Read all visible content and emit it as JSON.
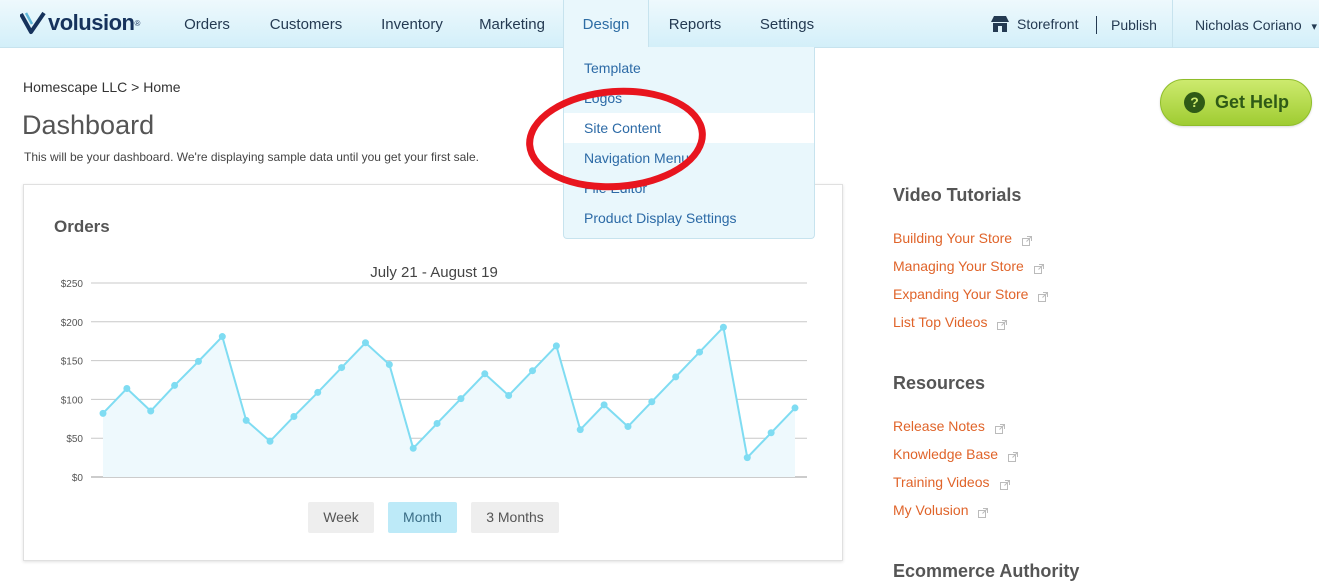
{
  "brand": {
    "name": "volusion",
    "reg": "®"
  },
  "nav": {
    "items": [
      "Orders",
      "Customers",
      "Inventory",
      "Marketing",
      "Design",
      "Reports",
      "Settings"
    ],
    "active": "Design",
    "storefront": "Storefront",
    "publish": "Publish",
    "user": "Nicholas Coriano",
    "user_caret": "▾"
  },
  "design_menu": {
    "items": [
      "Template",
      "Logos",
      "Site Content",
      "Navigation Menu",
      "File Editor",
      "Product Display Settings"
    ],
    "hover": "Site Content"
  },
  "breadcrumb": "Homescape LLC > Home",
  "page": {
    "title": "Dashboard",
    "subtitle": "This will be your dashboard. We're displaying sample data until you get your first sale."
  },
  "help": {
    "label": "Get Help",
    "icon": "?"
  },
  "orders_card": {
    "title": "Orders",
    "date_range": "July 21 - August 19",
    "range_buttons": [
      "Week",
      "Month",
      "3 Months"
    ],
    "active_range": "Month"
  },
  "chart_data": {
    "type": "area",
    "title": "July 21 - August 19",
    "xlabel": "",
    "ylabel": "",
    "ylim": [
      0,
      250
    ],
    "y_ticks": [
      "$0",
      "$50",
      "$100",
      "$150",
      "$200",
      "$250"
    ],
    "grid": true,
    "series": [
      {
        "values": [
          82,
          114,
          85,
          118,
          149,
          181,
          73,
          46,
          78,
          109,
          141,
          173,
          145,
          37,
          69,
          101,
          133,
          105,
          137,
          169,
          61,
          93,
          65,
          97,
          129,
          161,
          193,
          25,
          57,
          89
        ]
      }
    ],
    "line_color": "#7fdcf2",
    "fill_color": "#eef9fd"
  },
  "sidebar": {
    "video_tutorials": {
      "heading": "Video Tutorials",
      "links": [
        "Building Your Store",
        "Managing Your Store",
        "Expanding Your Store",
        "List Top Videos"
      ]
    },
    "resources": {
      "heading": "Resources",
      "links": [
        "Release Notes",
        "Knowledge Base",
        "Training Videos",
        "My Volusion"
      ]
    },
    "ecommerce_heading": "Ecommerce Authority"
  },
  "colors": {
    "accent_link": "#e0642a",
    "nav_link": "#2c6aa6",
    "annotation": "#e8151e",
    "help_green": "#9fcc32"
  }
}
